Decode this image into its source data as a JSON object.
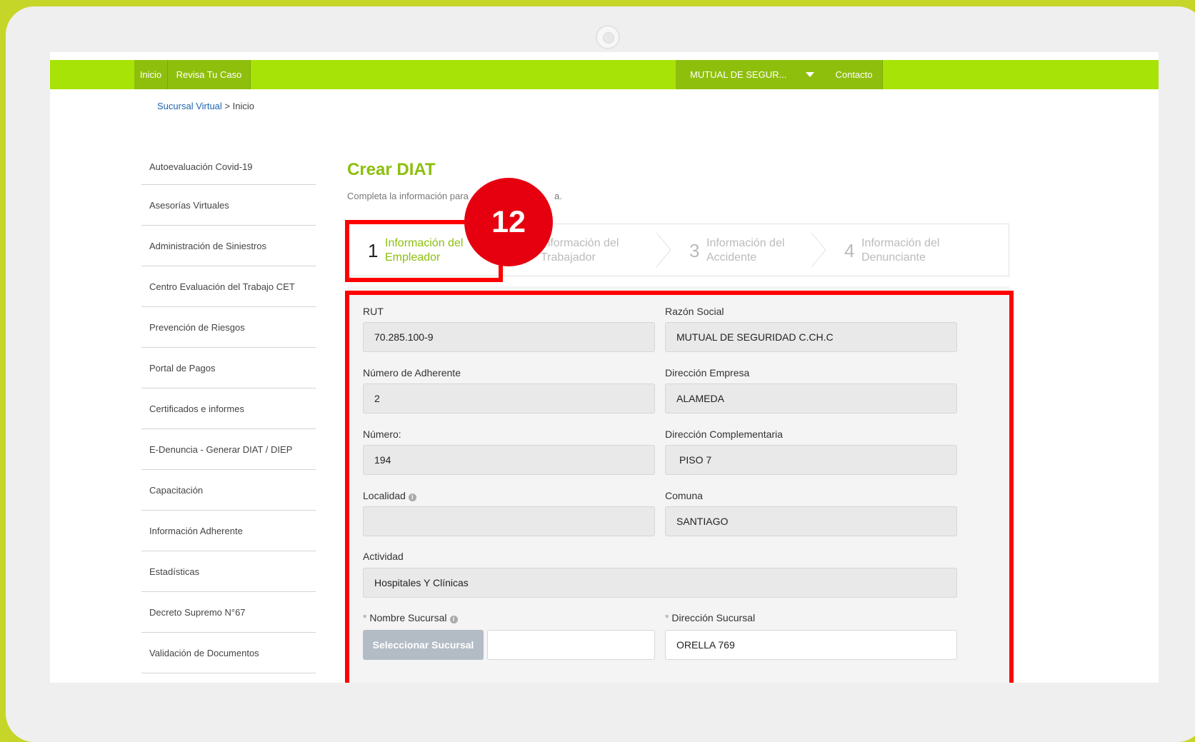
{
  "nav": {
    "inicio": "Inicio",
    "revisa": "Revisa Tu Caso",
    "org_dropdown": "MUTUAL DE SEGUR...",
    "contacto": "Contacto"
  },
  "breadcrumb": {
    "link": "Sucursal Virtual",
    "sep_current": "> Inicio"
  },
  "sidebar": {
    "items": [
      "Autoevaluación Covid-19",
      "Asesorías Virtuales",
      "Administración de Siniestros",
      "Centro Evaluación del Trabajo CET",
      "Prevención de Riesgos",
      "Portal de Pagos",
      "Certificados e informes",
      "E-Denuncia - Generar DIAT / DIEP",
      "Capacitación",
      "Información Adherente",
      "Estadísticas",
      "Decreto Supremo N°67",
      "Validación de Documentos"
    ]
  },
  "main": {
    "title": "Crear DIAT",
    "subtitle": "Completa la información para",
    "subtitle_end": "a."
  },
  "steps": [
    {
      "num": "1",
      "line1": "Información del",
      "line2": "Empleador"
    },
    {
      "num": "2",
      "line1": "Información del",
      "line2": "Trabajador"
    },
    {
      "num": "3",
      "line1": "Información del",
      "line2": "Accidente"
    },
    {
      "num": "4",
      "line1": "Información del",
      "line2": "Denunciante"
    }
  ],
  "form": {
    "rut": {
      "label": "RUT",
      "value": "70.285.100-9"
    },
    "razon": {
      "label": "Razón Social",
      "value": "MUTUAL DE SEGURIDAD C.CH.C"
    },
    "adherente": {
      "label": "Número de Adherente",
      "value": "2"
    },
    "direccion": {
      "label": "Dirección Empresa",
      "value": "ALAMEDA"
    },
    "numero": {
      "label": "Número:",
      "value": "194"
    },
    "complementaria": {
      "label": "Dirección Complementaria",
      "value": "PISO 7"
    },
    "localidad": {
      "label": "Localidad",
      "value": ""
    },
    "comuna": {
      "label": "Comuna",
      "value": "SANTIAGO"
    },
    "actividad": {
      "label": "Actividad",
      "value": "Hospitales Y Clínicas"
    },
    "nombre_sucursal": {
      "label": "Nombre Sucursal",
      "button": "Seleccionar Sucursal",
      "value": ""
    },
    "direccion_sucursal": {
      "label": "Dirección Sucursal",
      "value": "ORELLA  769"
    },
    "required_mark": "*",
    "info_icon": "i"
  },
  "annotation": {
    "badge": "12"
  },
  "colors": {
    "brand_green": "#a7e307",
    "title_green": "#8cbf0e",
    "highlight_red": "#ff0000",
    "badge_red": "#e6000f"
  }
}
